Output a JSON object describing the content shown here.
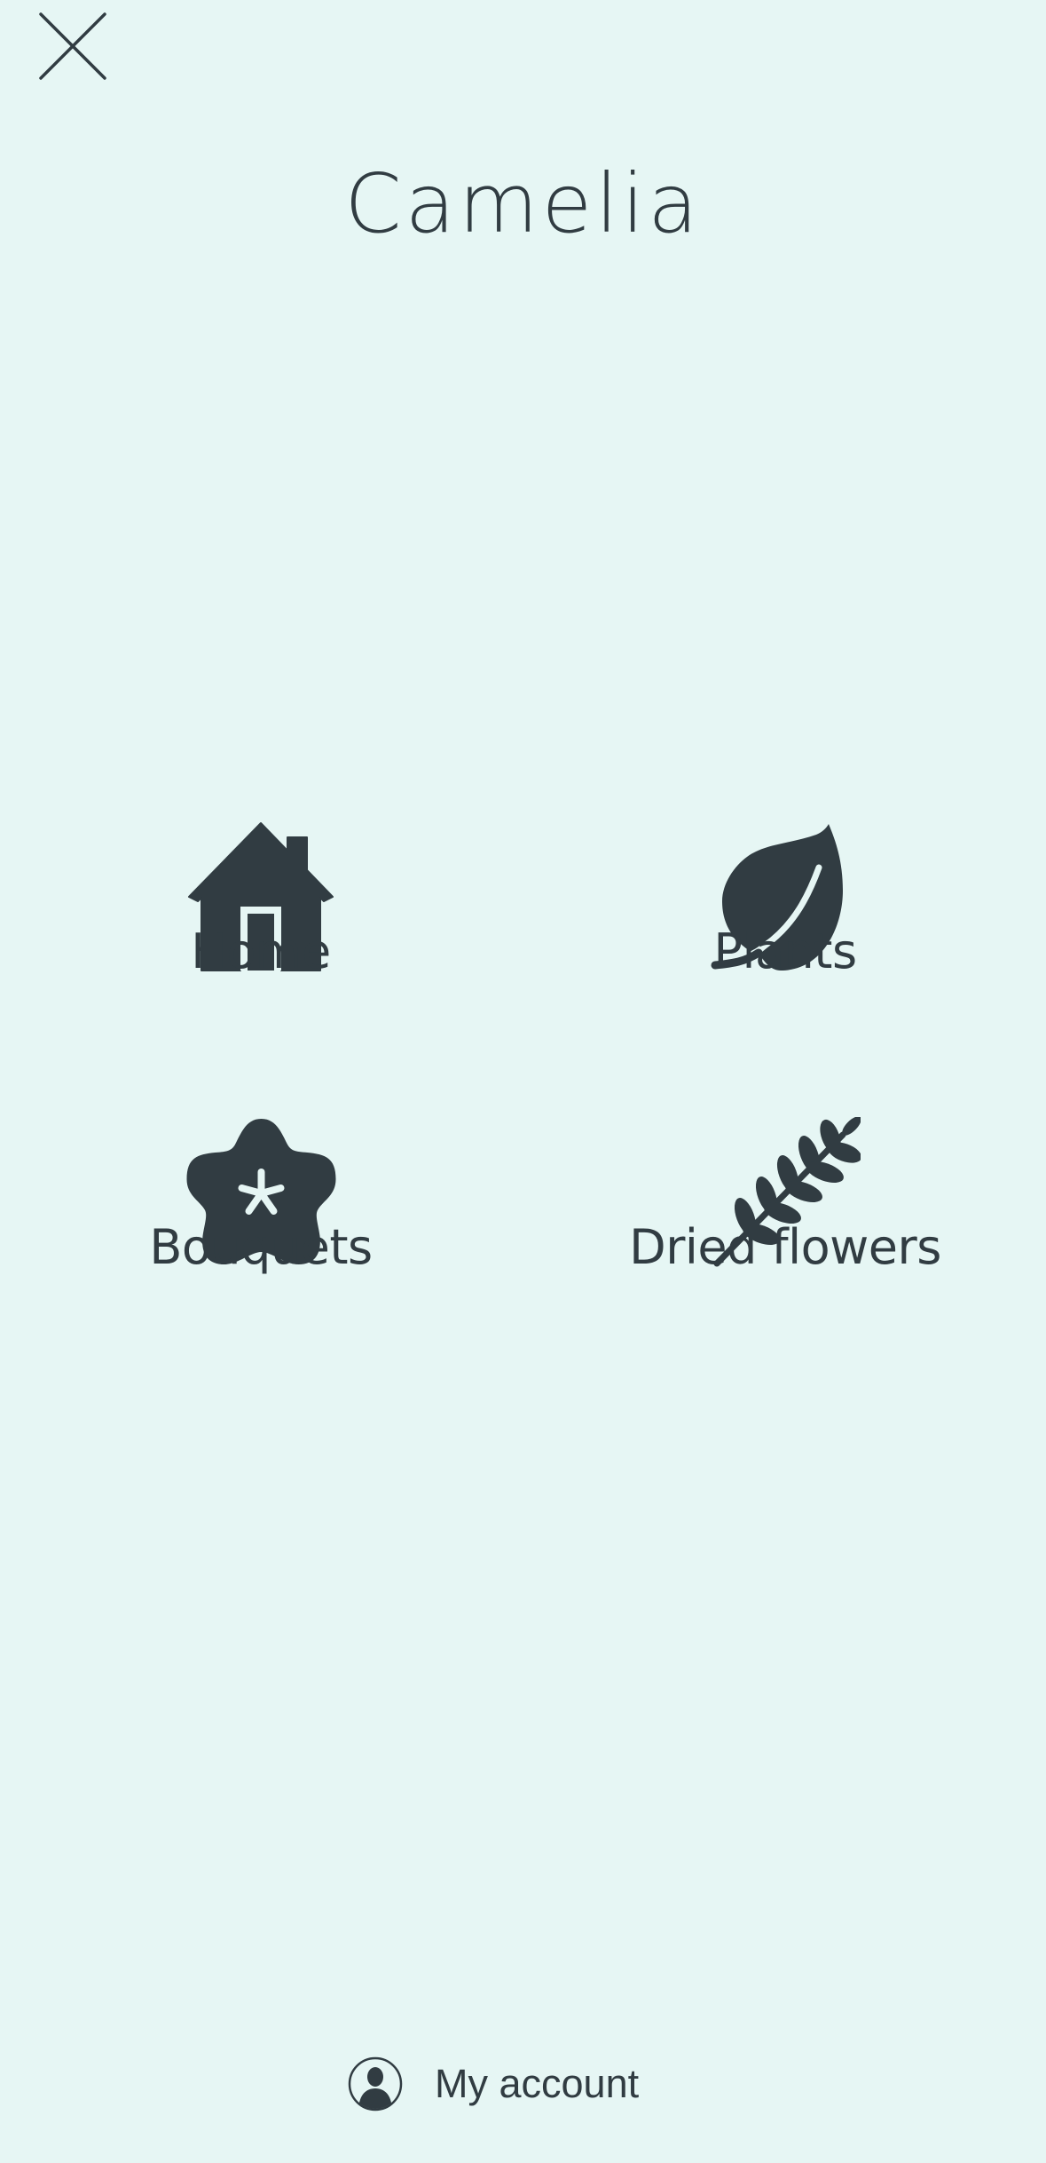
{
  "header": {
    "close_icon": "close-icon",
    "title": "Camelia"
  },
  "nav": {
    "items": [
      {
        "id": "home",
        "label": "Home",
        "icon": "house-icon"
      },
      {
        "id": "plants",
        "label": "Plants",
        "icon": "leaf-icon"
      },
      {
        "id": "bouquets",
        "label": "Bouquets",
        "icon": "flower-icon"
      },
      {
        "id": "dried",
        "label": "Dried flowers",
        "icon": "wheat-icon"
      }
    ]
  },
  "footer": {
    "account_label": "My account",
    "account_icon": "user-icon"
  },
  "colors": {
    "background": "#e6f6f4",
    "foreground": "#313c42"
  }
}
